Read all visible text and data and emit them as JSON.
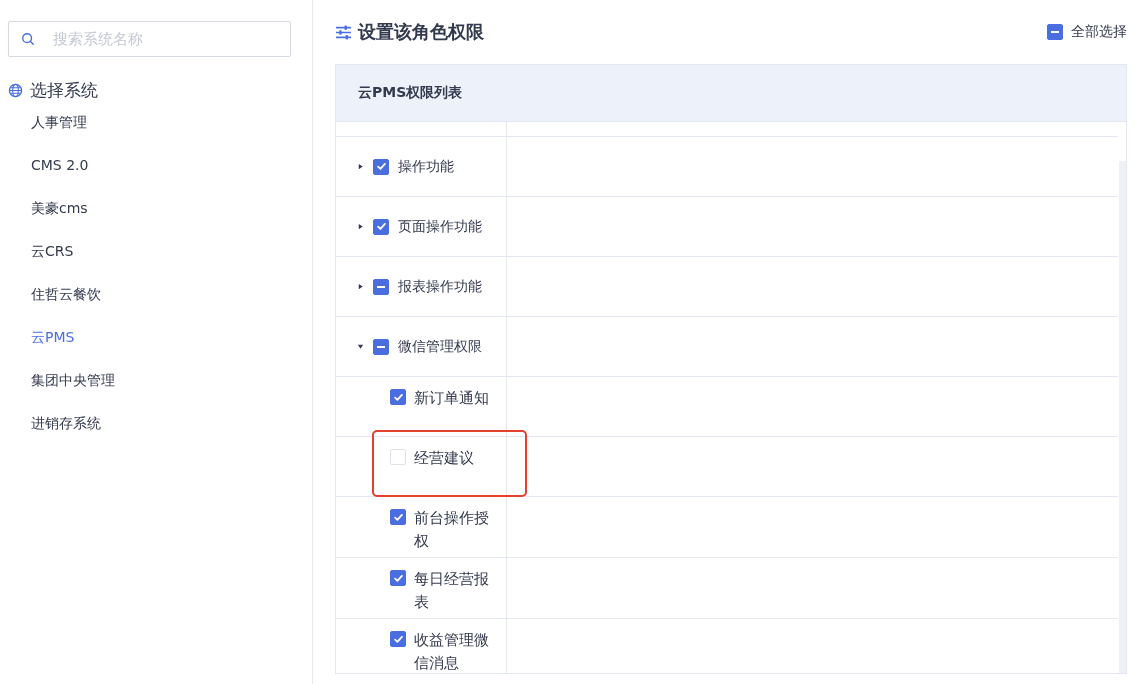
{
  "sidebar": {
    "search": {
      "placeholder": "搜索系统名称"
    },
    "section_title": "选择系统",
    "items": [
      {
        "label": "人事管理",
        "selected": false
      },
      {
        "label": "CMS 2.0",
        "selected": false
      },
      {
        "label": "美豪cms",
        "selected": false
      },
      {
        "label": "云CRS",
        "selected": false
      },
      {
        "label": "住哲云餐饮",
        "selected": false
      },
      {
        "label": "云PMS",
        "selected": true
      },
      {
        "label": "集团中央管理",
        "selected": false
      },
      {
        "label": "进销存系统",
        "selected": false
      }
    ]
  },
  "main": {
    "title": "设置该角色权限",
    "select_all": {
      "label": "全部选择",
      "checked": true,
      "partial": true
    },
    "table": {
      "title": "云PMS权限列表",
      "rows": [
        {
          "label": "操作功能",
          "checked": true,
          "partial": false,
          "expanded": false,
          "highlighted": false
        },
        {
          "label": "页面操作功能",
          "checked": true,
          "partial": false,
          "expanded": false,
          "highlighted": false
        },
        {
          "label": "报表操作功能",
          "checked": true,
          "partial": true,
          "expanded": false,
          "highlighted": false
        },
        {
          "label": "微信管理权限",
          "checked": true,
          "partial": true,
          "expanded": true,
          "highlighted": false,
          "children": [
            {
              "label": "新订单通知",
              "checked": true,
              "partial": false,
              "highlighted": false
            },
            {
              "label": "经营建议",
              "checked": false,
              "partial": false,
              "highlighted": true
            },
            {
              "label": "前台操作授权",
              "checked": true,
              "partial": false,
              "highlighted": false
            },
            {
              "label": "每日经营报表",
              "checked": true,
              "partial": false,
              "highlighted": false
            },
            {
              "label": "收益管理微信消息",
              "checked": true,
              "partial": false,
              "highlighted": false
            }
          ]
        }
      ]
    }
  }
}
